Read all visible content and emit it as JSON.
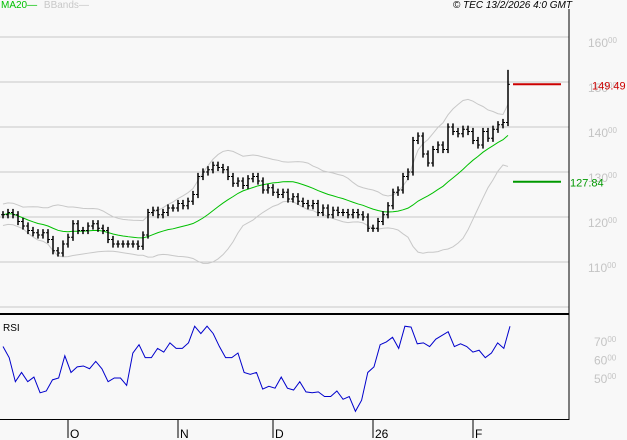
{
  "header": {
    "legend": [
      {
        "label": "MA20",
        "color": "#00c000"
      },
      {
        "label": "BBands",
        "color": "#c8c8c8"
      }
    ],
    "copyright": "© TEC 13/2/2026 4:0 GMT"
  },
  "chart_data": {
    "type": "ohlc",
    "price_axis": {
      "ticks": [
        110,
        120,
        130,
        140,
        150,
        160
      ],
      "range": [
        100,
        165
      ]
    },
    "close": [
      120.5,
      121,
      120.5,
      119,
      118,
      117,
      116.5,
      116,
      116.5,
      115,
      112.5,
      112,
      114,
      115.5,
      118.5,
      117,
      117,
      118,
      118.5,
      117.5,
      117,
      115,
      114,
      114,
      114,
      114,
      114,
      113.5,
      116,
      121,
      121.5,
      120.5,
      121,
      122,
      122,
      123,
      122.5,
      123.5,
      125,
      129,
      130,
      130.5,
      131.5,
      131,
      130.5,
      129,
      127.5,
      128,
      127,
      128.5,
      129,
      128,
      126,
      126.5,
      125.5,
      125,
      125.5,
      124,
      124.5,
      123.5,
      123,
      122.5,
      123,
      121,
      122,
      120.5,
      121.5,
      121,
      121,
      120.5,
      121,
      120.5,
      120,
      117.5,
      117.5,
      119,
      120.5,
      122.5,
      125.5,
      126,
      129,
      130,
      137,
      138,
      134,
      132,
      135,
      136,
      135,
      140,
      139,
      138.5,
      139.5,
      139,
      137,
      136,
      139,
      137.5,
      139.5,
      140.5,
      141,
      149.49
    ],
    "last_high": 152.7,
    "indicators": [
      "MA20",
      "BBands"
    ],
    "markers": [
      {
        "value": 149.49,
        "label": "149.49",
        "color": "#cc0000"
      },
      {
        "value": 127.84,
        "label": "127.84",
        "color": "#009900"
      }
    ],
    "x_ticks": [
      {
        "label": "O",
        "bar": 13
      },
      {
        "label": "N",
        "bar": 35
      },
      {
        "label": "D",
        "bar": 54
      },
      {
        "label": "26",
        "bar": 74
      },
      {
        "label": "F",
        "bar": 94
      }
    ],
    "rsi": {
      "title": "RSI",
      "ticks": [
        50,
        60,
        70
      ],
      "color": "#0000cc",
      "values": [
        67,
        61,
        48,
        53,
        48,
        50.5,
        42,
        43,
        49,
        50,
        62,
        53,
        56,
        56.5,
        55,
        59,
        55,
        48,
        50,
        50,
        46,
        63.5,
        68,
        61,
        61,
        66,
        64,
        69,
        66,
        66,
        69,
        78,
        74,
        78,
        74,
        67,
        61,
        61,
        63.5,
        53,
        52,
        53,
        44,
        45.5,
        44.5,
        50.5,
        44.5,
        43.5,
        48,
        42.5,
        42,
        42.5,
        40,
        40,
        43,
        38.5,
        40,
        32,
        38,
        53,
        56,
        68,
        69.5,
        72,
        66,
        78,
        77.5,
        68.5,
        69,
        67,
        71,
        73,
        75,
        67,
        68.5,
        67,
        64,
        65,
        61,
        63.5,
        69,
        66,
        78
      ]
    }
  }
}
